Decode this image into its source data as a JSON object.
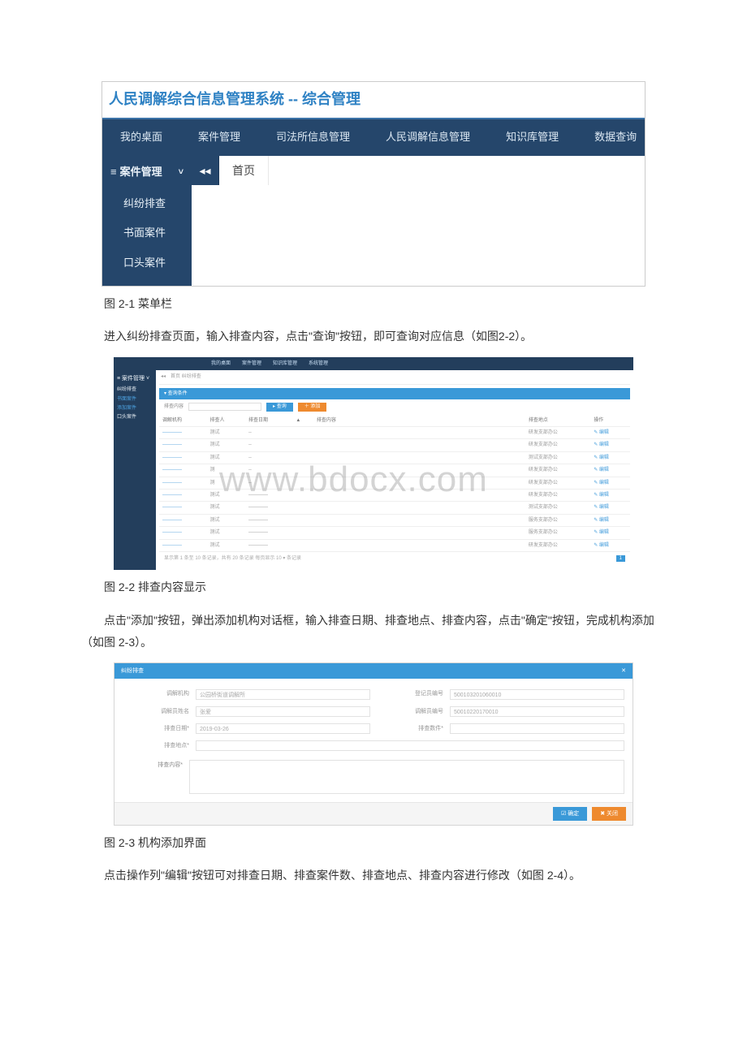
{
  "systemTitle": "人民调解综合信息管理系统 -- 综合管理",
  "nav": [
    "我的桌面",
    "案件管理",
    "司法所信息管理",
    "人民调解信息管理",
    "知识库管理",
    "数据查询"
  ],
  "sidebarTitle": "案件管理",
  "sidebarItems": [
    "纠纷排查",
    "书面案件",
    "口头案件"
  ],
  "breadcrumbTab": "首页",
  "cap21": "图 2-1 菜单栏",
  "p1": "进入纠纷排查页面，输入排查内容，点击\"查询\"按钮，即可查询对应信息（如图2-2）。",
  "fig22": {
    "nav": [
      "我的桌面",
      "案件管理",
      "知识库管理",
      "系统管理"
    ],
    "sideHead": "≡ 案件管理 ˅",
    "sideItems": [
      "纠纷排查",
      "书面案件",
      "添加案件",
      "口头案件"
    ],
    "tabs": "首页   纠纷排查",
    "sectionHeader": "▾ 查询条件",
    "searchLabel": "排查内容",
    "btnQuery": "▸ 查询",
    "btnAdd": "＋ 添加",
    "columns": [
      "调解机构",
      "排查人",
      "排查日期",
      "▲",
      "排查内容",
      "排查地点",
      "操作"
    ],
    "opEdit": "✎ 编辑",
    "rows": [
      {
        "org": "————",
        "person": "测试",
        "date": "--",
        "loc": "研发支部办公"
      },
      {
        "org": "————",
        "person": "测试",
        "date": "--",
        "loc": "研发支部办公"
      },
      {
        "org": "————",
        "person": "测试",
        "date": "--",
        "loc": "测试支部办公"
      },
      {
        "org": "————",
        "person": "测",
        "date": "--",
        "loc": "研发支部办公"
      },
      {
        "org": "————",
        "person": "测",
        "date": "--",
        "loc": "研发支部办公"
      },
      {
        "org": "————",
        "person": "测试",
        "date": "————",
        "loc": "研发支部办公"
      },
      {
        "org": "————",
        "person": "测试",
        "date": "————",
        "loc": "测试支部办公"
      },
      {
        "org": "————",
        "person": "测试",
        "date": "————",
        "loc": "服务支部办公"
      },
      {
        "org": "————",
        "person": "测试",
        "date": "————",
        "loc": "服务支部办公"
      },
      {
        "org": "————",
        "person": "测试",
        "date": "————",
        "loc": "研发支部办公"
      }
    ],
    "pagerInfo": "显示第 1 条至 10 条记录，共有 20 条记录 每页显示  10 ▾  条记录",
    "pageBtn": "1",
    "watermark": "www.bdocx.com"
  },
  "cap22": "图 2-2 排查内容显示",
  "p2": "点击\"添加\"按钮，弹出添加机构对话框，输入排查日期、排查地点、排查内容，点击\"确定\"按钮，完成机构添加（如图 2-3）。",
  "fig23": {
    "dialogTitle": "纠纷排查",
    "closeX": "✕",
    "fields": {
      "org_lbl": "调解机构",
      "org_val": "公园桥街道调解所",
      "reg_lbl": "登记员编号",
      "reg_val": "500103201060010",
      "comm_lbl": "调解员姓名",
      "comm_val": "张爱",
      "commno_lbl": "调解员编号",
      "commno_val": "50010220170010",
      "date_lbl": "排查日期*",
      "date_val": "2019-03-26",
      "cases_lbl": "排查数件*",
      "cases_val": "",
      "loc_lbl": "排查地点*",
      "loc_val": "",
      "content_lbl": "排查内容*"
    },
    "btnOk": "☑ 确定",
    "btnCancel": "✖ 关闭"
  },
  "cap23": "图 2-3 机构添加界面",
  "p3": "点击操作列\"编辑\"按钮可对排查日期、排查案件数、排查地点、排查内容进行修改（如图 2-4）。"
}
